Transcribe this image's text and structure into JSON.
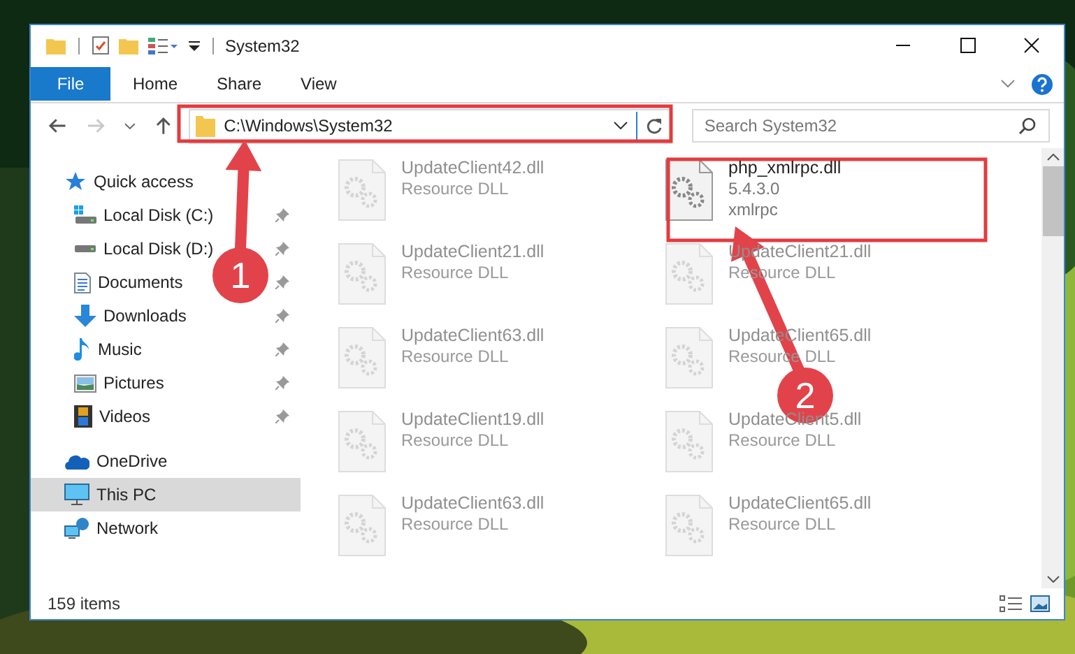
{
  "window": {
    "title": "System32"
  },
  "ribbon_tabs": [
    {
      "label": "File",
      "kind": "file"
    },
    {
      "label": "Home",
      "kind": "tab"
    },
    {
      "label": "Share",
      "kind": "tab"
    },
    {
      "label": "View",
      "kind": "tab"
    }
  ],
  "address": {
    "value": "C:\\Windows\\System32"
  },
  "search": {
    "placeholder": "Search System32"
  },
  "sidebar": {
    "items": [
      {
        "label": "Quick access",
        "kind": "star",
        "selected": false,
        "children": [
          {
            "label": "Local Disk (C:)",
            "kind": "systemdrive",
            "selected": false,
            "pinned": true
          },
          {
            "label": "Local Disk (D:)",
            "kind": "drive",
            "selected": false,
            "pinned": true
          },
          {
            "label": "Documents",
            "kind": "document",
            "selected": false,
            "pinned": true
          },
          {
            "label": "Downloads",
            "kind": "download",
            "selected": false,
            "pinned": true
          },
          {
            "label": "Music",
            "kind": "music",
            "selected": false,
            "pinned": true
          },
          {
            "label": "Pictures",
            "kind": "picture",
            "selected": false,
            "pinned": true
          },
          {
            "label": "Videos",
            "kind": "video",
            "selected": false,
            "pinned": true
          }
        ]
      },
      {
        "label": "OneDrive",
        "kind": "cloud",
        "selected": false
      },
      {
        "label": "This PC",
        "kind": "computer",
        "selected": true
      },
      {
        "label": "Network",
        "kind": "network",
        "selected": false
      }
    ]
  },
  "files": [
    {
      "name": "UpdateClient42.dll",
      "details": [
        "Resource DLL"
      ],
      "blurred": true
    },
    {
      "name": "php_xmlrpc.dll",
      "details": [
        "5.4.3.0",
        "xmlrpc"
      ],
      "blurred": false
    },
    {
      "name": "UpdateClient21.dll",
      "details": [
        "Resource DLL"
      ],
      "blurred": true
    },
    {
      "name": "UpdateClient21.dll",
      "details": [
        "Resource DLL"
      ],
      "blurred": true
    },
    {
      "name": "UpdateClient63.dll",
      "details": [
        "Resource DLL"
      ],
      "blurred": true
    },
    {
      "name": "UpdateClient65.dll",
      "details": [
        "Resource DLL"
      ],
      "blurred": true
    },
    {
      "name": "UpdateClient19.dll",
      "details": [
        "Resource DLL"
      ],
      "blurred": true
    },
    {
      "name": "UpdateClient5.dll",
      "details": [
        "Resource DLL"
      ],
      "blurred": true
    },
    {
      "name": "UpdateClient63.dll",
      "details": [
        "Resource DLL"
      ],
      "blurred": true
    },
    {
      "name": "UpdateClient65.dll",
      "details": [
        "Resource DLL"
      ],
      "blurred": true
    }
  ],
  "status_bar": {
    "count": "159 items"
  },
  "callouts": [
    {
      "label": "1"
    },
    {
      "label": "2"
    }
  ]
}
